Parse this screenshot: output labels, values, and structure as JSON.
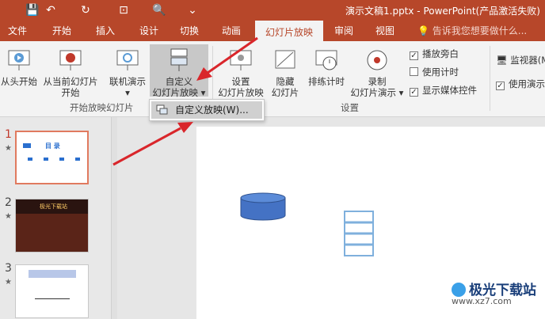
{
  "window": {
    "title": "演示文稿1.pptx - PowerPoint(产品激活失败)",
    "qat": {
      "save": "💾",
      "undo": "↶",
      "redo": "↻",
      "present": "⊡",
      "preview": "🔍",
      "more": "⌄"
    },
    "controls": {
      "restore": "⧉",
      "minimize": "—",
      "maximize": "□"
    }
  },
  "tabs": [
    "文件",
    "开始",
    "插入",
    "设计",
    "切换",
    "动画",
    "幻灯片放映",
    "审阅",
    "视图"
  ],
  "active_tab": "幻灯片放映",
  "tell_me": "告诉我您想要做什么...",
  "ribbon": {
    "start_group": {
      "label": "开始放映幻灯片",
      "from_beginning": "从头开始",
      "from_current_1": "从当前幻灯片",
      "from_current_2": "开始",
      "online_1": "联机演示",
      "online_arrow": "▾",
      "custom_1": "自定义",
      "custom_2": "幻灯片放映 ▾"
    },
    "setup_group": {
      "label": "设置",
      "setup_1": "设置",
      "setup_2": "幻灯片放映",
      "hide_1": "隐藏",
      "hide_2": "幻灯片",
      "rehearse": "排练计时",
      "record_1": "录制",
      "record_2": "幻灯片演示 ▾",
      "play_narration": "播放旁白",
      "use_timings": "使用计时",
      "show_media": "显示媒体控件"
    },
    "monitors_group": {
      "monitor": "监视器(M",
      "presenter_view": "使用演示"
    }
  },
  "dropdown": {
    "item": "自定义放映(W)..."
  },
  "slides": [
    {
      "num": "1",
      "star": "★",
      "title": "目  录"
    },
    {
      "num": "2",
      "star": "★",
      "title": "极光下载站"
    },
    {
      "num": "3",
      "star": "★",
      "title": ""
    }
  ],
  "watermark": {
    "brand": "极光下载站",
    "url": "www.xz7.com"
  },
  "colors": {
    "accent": "#b7472a",
    "arrow": "#d9262b",
    "shape_fill": "#4472c4"
  }
}
